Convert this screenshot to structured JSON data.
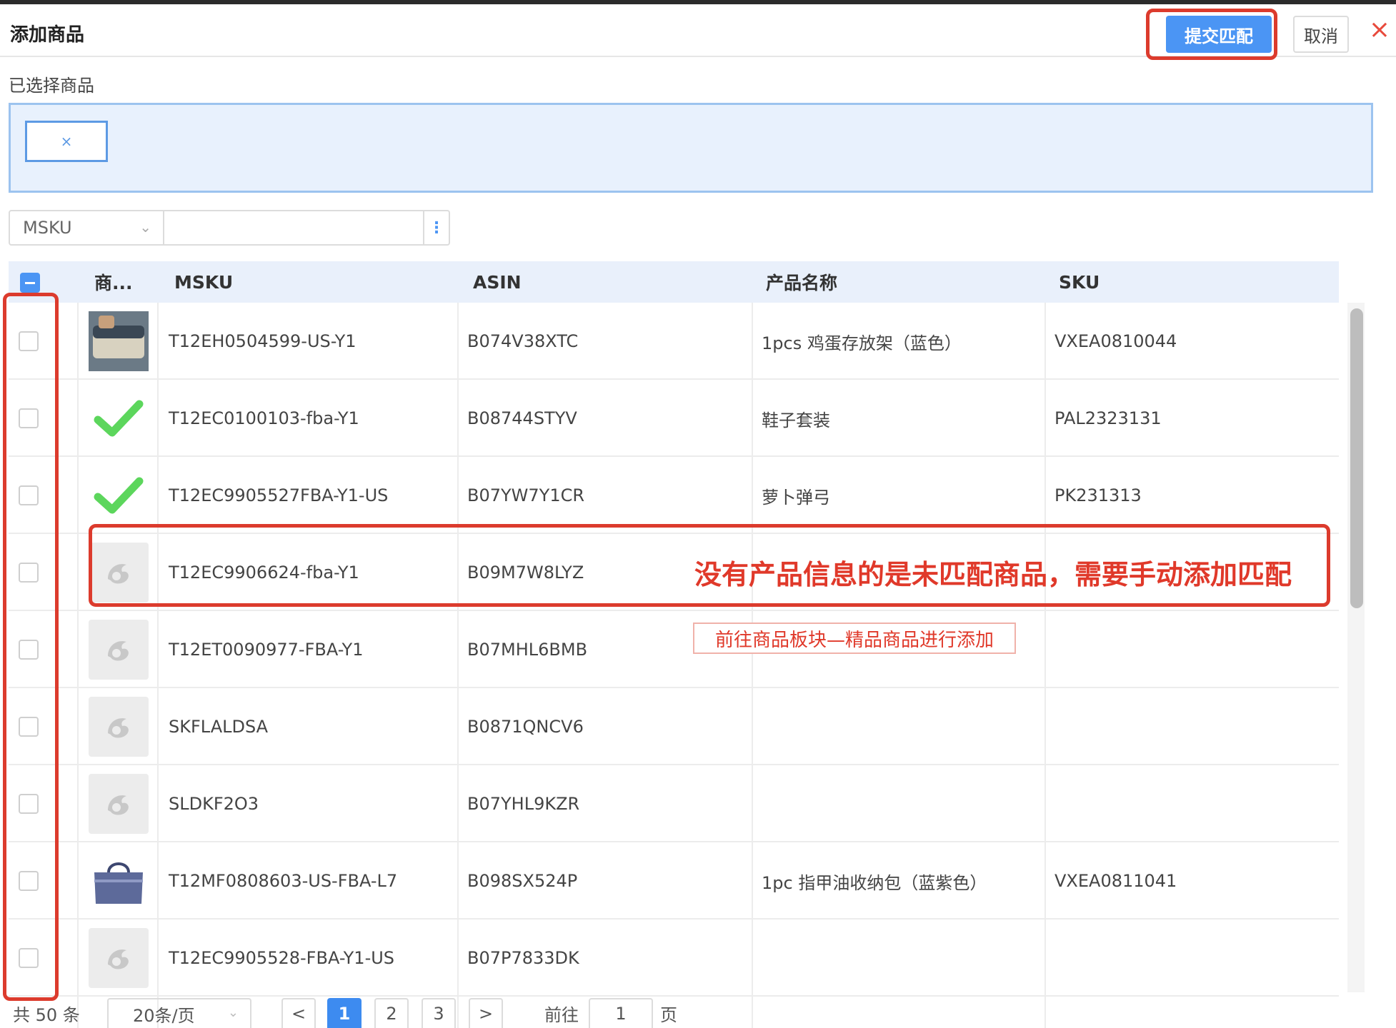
{
  "header": {
    "title": "添加商品",
    "submit_label": "提交匹配",
    "cancel_label": "取消",
    "close_icon": "×"
  },
  "selected": {
    "label": "已选择商品",
    "chip_close": "×"
  },
  "search": {
    "field": "MSKU",
    "value": "",
    "more_icon": "⋮"
  },
  "table": {
    "columns": [
      "商...",
      "MSKU",
      "ASIN",
      "产品名称",
      "SKU"
    ],
    "rows": [
      {
        "image": "storage-box",
        "msku": "T12EH0504599-US-Y1",
        "asin": "B074V38XTC",
        "name": "1pcs 鸡蛋存放架（蓝色）",
        "sku": "VXEA0810044"
      },
      {
        "image": "checkmark",
        "msku": "T12EC0100103-fba-Y1",
        "asin": "B08744STYV",
        "name": "鞋子套装",
        "sku": "PAL2323131"
      },
      {
        "image": "checkmark",
        "msku": "T12EC9905527FBA-Y1-US",
        "asin": "B07YW7Y1CR",
        "name": "萝卜弹弓",
        "sku": "PK231313"
      },
      {
        "image": "placeholder",
        "msku": "T12EC9906624-fba-Y1",
        "asin": "B09M7W8LYZ",
        "name": "",
        "sku": ""
      },
      {
        "image": "placeholder",
        "msku": "T12ET0090977-FBA-Y1",
        "asin": "B07MHL6BMB",
        "name": "",
        "sku": ""
      },
      {
        "image": "placeholder",
        "msku": "SKFLALDSA",
        "asin": "B0871QNCV6",
        "name": "",
        "sku": ""
      },
      {
        "image": "placeholder",
        "msku": "SLDKF2O3",
        "asin": "B07YHL9KZR",
        "name": "",
        "sku": ""
      },
      {
        "image": "bag",
        "msku": "T12MF0808603-US-FBA-L7",
        "asin": "B098SX524P",
        "name": "1pc 指甲油收纳包（蓝紫色）",
        "sku": "VXEA0811041"
      },
      {
        "image": "placeholder",
        "msku": "T12EC9905528-FBA-Y1-US",
        "asin": "B07P7833DK",
        "name": "",
        "sku": ""
      }
    ]
  },
  "annotations": {
    "main": "没有产品信息的是未匹配商品，需要手动添加匹配",
    "sub": "前往商品板块—精品商品进行添加"
  },
  "pagination": {
    "total": "共 50 条",
    "page_size": "20条/页",
    "prev": "<",
    "next": ">",
    "pages": [
      "1",
      "2",
      "3"
    ],
    "current_page": "1",
    "goto_label": "前往",
    "goto_value": "1",
    "page_unit": "页"
  },
  "colors": {
    "primary": "#4b95f4",
    "annotation_red": "#e0392a",
    "check_green": "#5cd65c"
  }
}
